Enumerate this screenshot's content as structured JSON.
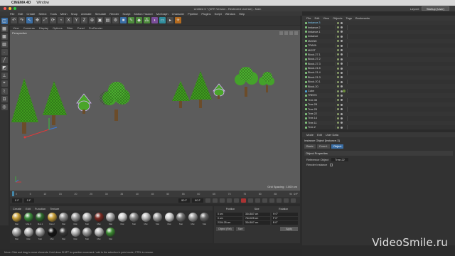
{
  "mac": {
    "app": "CINEMA 4D",
    "menu": "Window"
  },
  "window": {
    "title": "Untitled 5 * (NFR Version - Restricted License) - Main",
    "layout_label": "Layout:",
    "layout_value": "Startup (User)"
  },
  "main_menu": [
    "File",
    "Edit",
    "Create",
    "Select",
    "Tools",
    "Mesh",
    "Snap",
    "Animate",
    "Simulate",
    "Render",
    "Sculpt",
    "Motion Tracker",
    "MoGraph",
    "Character",
    "Pipeline",
    "Plugins",
    "Script",
    "Window",
    "Help"
  ],
  "viewport": {
    "menu": [
      "View",
      "Cameras",
      "Display",
      "Options",
      "Filter",
      "Panel",
      "ProRender"
    ],
    "label": "Perspective",
    "grid_spacing": "Grid Spacing : 1000 cm"
  },
  "timeline": {
    "ticks": [
      "0",
      "5",
      "10",
      "15",
      "20",
      "25",
      "30",
      "35",
      "40",
      "45",
      "50",
      "55",
      "60",
      "65",
      "70",
      "75",
      "80",
      "85",
      "90"
    ],
    "end": "0 F"
  },
  "transport": {
    "current": "0 F",
    "start": "0 F",
    "end": "90 F",
    "max": "90 F"
  },
  "materials": {
    "menu": [
      "Create",
      "Edit",
      "Function",
      "Texture"
    ],
    "items": [
      {
        "name": "Mat",
        "color": "#caa23a"
      },
      {
        "name": "Mat.3",
        "color": "#3a8a3a"
      },
      {
        "name": "Mat.1",
        "color": "#2e6b2e"
      },
      {
        "name": "Mat.2",
        "color": "#c9a03a"
      },
      {
        "name": "Mat",
        "color": "#8c8c8c"
      },
      {
        "name": "Mat",
        "color": "#9a9a9a"
      },
      {
        "name": "Mat",
        "color": "#b3b3b3"
      },
      {
        "name": "Mat",
        "color": "#7a2a22"
      },
      {
        "name": "Mat",
        "color": "#a8a8a8"
      },
      {
        "name": "Mat",
        "color": "#cfcfcf"
      },
      {
        "name": "Mat",
        "color": "#8a8a8a"
      },
      {
        "name": "Mat",
        "color": "#bdbdbd"
      },
      {
        "name": "Mat",
        "color": "#9c9c9c"
      },
      {
        "name": "Mat",
        "color": "#d0d0d0"
      },
      {
        "name": "Mat",
        "color": "#777777"
      },
      {
        "name": "Mat",
        "color": "#9f9f9f"
      },
      {
        "name": "Mat",
        "color": "#666666"
      },
      {
        "name": "Mat",
        "color": "#aaaaaa"
      },
      {
        "name": "Mat",
        "color": "#b9b9b9"
      },
      {
        "name": "Mat",
        "color": "#a0a0a0"
      },
      {
        "name": "Mat",
        "color": "#141414"
      },
      {
        "name": "Mat",
        "color": "#3a3a3a"
      },
      {
        "name": "Mat",
        "color": "#b8b8b8"
      },
      {
        "name": "Mat",
        "color": "#999999"
      },
      {
        "name": "Mat",
        "color": "#bbbbbb"
      },
      {
        "name": "Mat",
        "color": "#3d8c33"
      }
    ]
  },
  "coordinates": {
    "headers": [
      "Position",
      "Size",
      "Rotation"
    ],
    "rows": [
      [
        "0 cm",
        "334.847 cm",
        "H 0°"
      ],
      [
        "0 cm",
        "764.025 cm",
        "P 0°"
      ],
      [
        "2104.25 cm",
        "334.847 cm",
        "B 0°"
      ]
    ],
    "mode": "Object (Rel)",
    "size_mode": "Size",
    "apply": "Apply"
  },
  "object_manager": {
    "menu": [
      "File",
      "Edit",
      "View",
      "Objects",
      "Tags",
      "Bookmarks"
    ],
    "objects": [
      {
        "name": "Instance.3",
        "selected": true
      },
      {
        "name": "Instance.2"
      },
      {
        "name": "Instance.1"
      },
      {
        "name": "Instance"
      },
      {
        "name": "MAYAK"
      },
      {
        "name": "TRAVA"
      },
      {
        "name": "MOST"
      },
      {
        "name": "Block.27.1"
      },
      {
        "name": "Block.27.2"
      },
      {
        "name": "Block.27.3"
      },
      {
        "name": "Block.21.5"
      },
      {
        "name": "Block.21.4"
      },
      {
        "name": "Block.21.3"
      },
      {
        "name": "Block.20.1"
      },
      {
        "name": "Block.20"
      },
      {
        "name": "Cube",
        "cube": true
      },
      {
        "name": "TREES"
      },
      {
        "name": "Tree.35"
      },
      {
        "name": "Tree.28"
      },
      {
        "name": "Tree.25"
      },
      {
        "name": "Tree.22"
      },
      {
        "name": "Tree.14"
      },
      {
        "name": "Tree.11"
      },
      {
        "name": "Tree.2"
      }
    ]
  },
  "attribute_manager": {
    "menu": [
      "Mode",
      "Edit",
      "User Data"
    ],
    "object": "Instance Object [Instance.3]",
    "tabs": [
      "Basic",
      "Coord.",
      "Object"
    ],
    "active_tab": "Object",
    "section": "Object Properties",
    "ref_label": "Reference Object",
    "ref_value": "Tree.22",
    "render_label": "Render Instance"
  },
  "status": "Move: Click and drag to move elements. Hold down SHIFT to quantize movement / add to the selection in point mode, CTRL to remove.",
  "watermark": "VideoSmile.ru"
}
